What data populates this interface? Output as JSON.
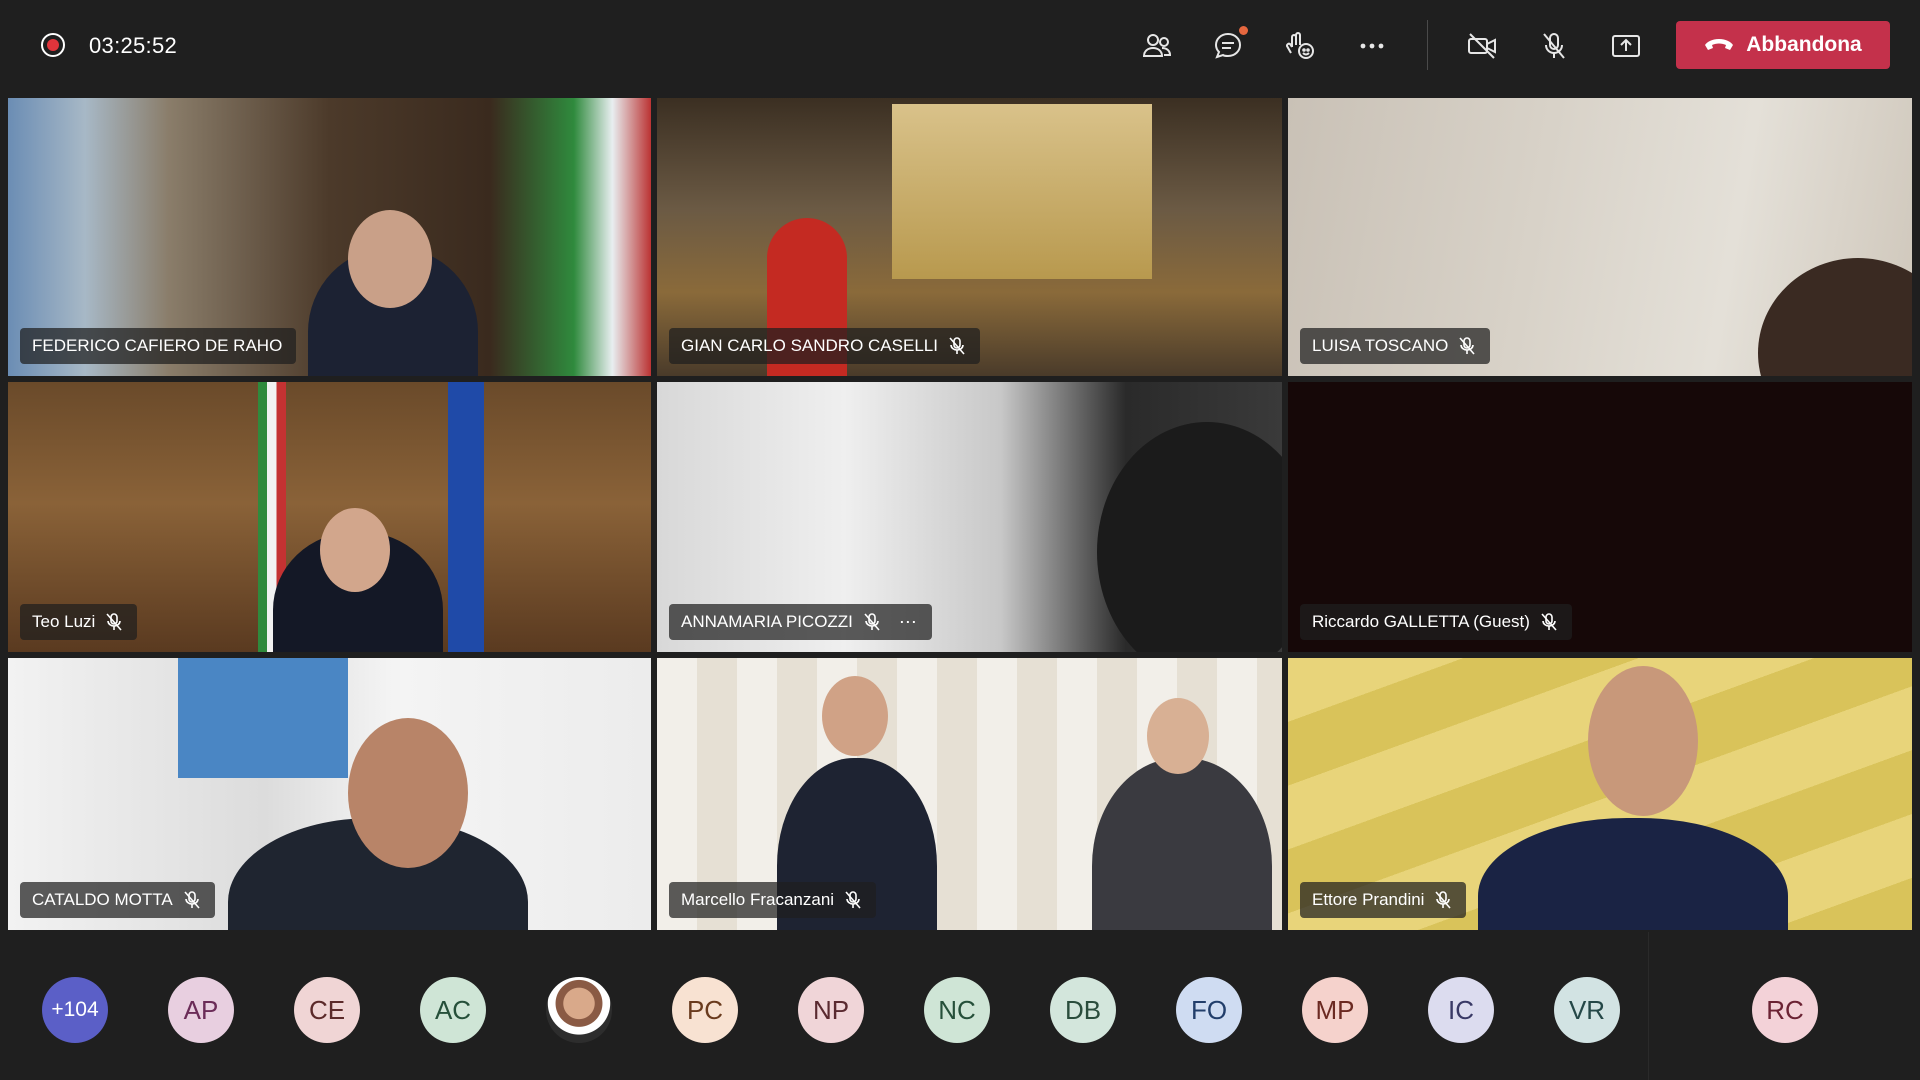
{
  "meeting": {
    "timer": "03:25:52",
    "leave_label": "Abbandona"
  },
  "toolbar": {
    "icons": [
      "record-icon",
      "participants-icon",
      "chat-icon",
      "reactions-icon",
      "more-icon",
      "camera-off-icon",
      "mic-off-icon",
      "share-icon",
      "hang-up-icon"
    ],
    "leave_color": "#c4314b"
  },
  "tiles": [
    {
      "name": "FEDERICO CAFIERO DE RAHO",
      "muted": false
    },
    {
      "name": "GIAN CARLO SANDRO CASELLI",
      "muted": true
    },
    {
      "name": "LUISA TOSCANO",
      "muted": true
    },
    {
      "name": "Teo Luzi",
      "muted": true
    },
    {
      "name": "ANNAMARIA PICOZZI",
      "muted": true,
      "more": "⋯"
    },
    {
      "name": "Riccardo GALLETTA (Guest)",
      "muted": true
    },
    {
      "name": "CATALDO MOTTA",
      "muted": true
    },
    {
      "name": "Marcello Fracanzani",
      "muted": true
    },
    {
      "name": "Ettore Prandini",
      "muted": true
    }
  ],
  "roster": [
    {
      "initials": "+104",
      "bg": "#5b5fc7",
      "fg": "#ffffff"
    },
    {
      "initials": "AP",
      "bg": "#e8cfe0",
      "fg": "#6b2c58"
    },
    {
      "initials": "CE",
      "bg": "#f0d5d5",
      "fg": "#5c2a2a"
    },
    {
      "initials": "AC",
      "bg": "#cfe5d6",
      "fg": "#26503a"
    },
    {
      "initials": "",
      "bg": "#888888",
      "fg": "#ffffff"
    },
    {
      "initials": "PC",
      "bg": "#f8e2d2",
      "fg": "#6a3b1e"
    },
    {
      "initials": "NP",
      "bg": "#f0d5d8",
      "fg": "#5a2a30"
    },
    {
      "initials": "NC",
      "bg": "#cfe5d6",
      "fg": "#26503a"
    },
    {
      "initials": "DB",
      "bg": "#d3e6dc",
      "fg": "#2a4d3c"
    },
    {
      "initials": "FO",
      "bg": "#cfdcf2",
      "fg": "#223e6b"
    },
    {
      "initials": "MP",
      "bg": "#f5d2cc",
      "fg": "#6b2a22"
    },
    {
      "initials": "IC",
      "bg": "#dcdcef",
      "fg": "#3a3a66"
    },
    {
      "initials": "VR",
      "bg": "#d2e3e3",
      "fg": "#254848"
    },
    {
      "initials": "RC",
      "bg": "#f3d2d8",
      "fg": "#6b2334"
    }
  ]
}
